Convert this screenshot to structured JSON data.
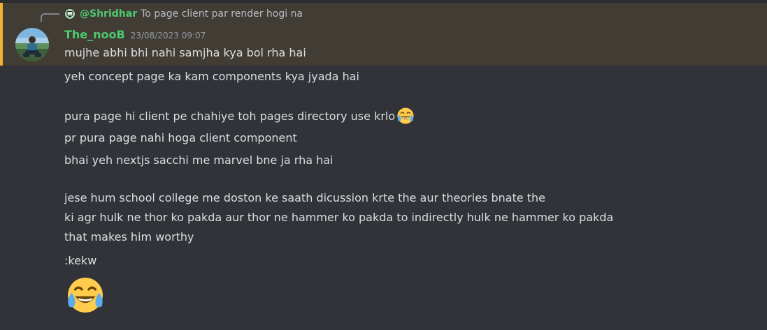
{
  "reply": {
    "mention": "@Shridhar",
    "text": "To page client par render hogi na"
  },
  "message": {
    "username": "The_nooB",
    "timestamp": "23/08/2023 09:07",
    "lines": [
      "mujhe abhi bhi nahi samjha kya bol rha hai",
      "yeh concept page ka kam components kya jyada hai",
      "pura page hi client pe chahiye toh pages directory use krlo",
      "pr pura page nahi hoga client component",
      "bhai yeh nextjs sacchi me marvel bne ja rha hai",
      "jese hum school college me doston ke saath dicussion krte the aur theories bnate the",
      "ki agr hulk ne thor ko pakda aur thor ne hammer ko pakda to indirectly hulk ne hammer ko pakda",
      "that makes him worthy",
      ":kekw"
    ],
    "inline_emoji": "face-with-tears-of-joy-icon",
    "big_emoji": "face-with-tears-of-joy-icon"
  },
  "colors": {
    "background": "#313338",
    "mention_highlight": "#413d35",
    "mention_bar": "#f0b232",
    "username": "#4ec970",
    "text": "#dbdee1",
    "timestamp": "#949ba4"
  }
}
